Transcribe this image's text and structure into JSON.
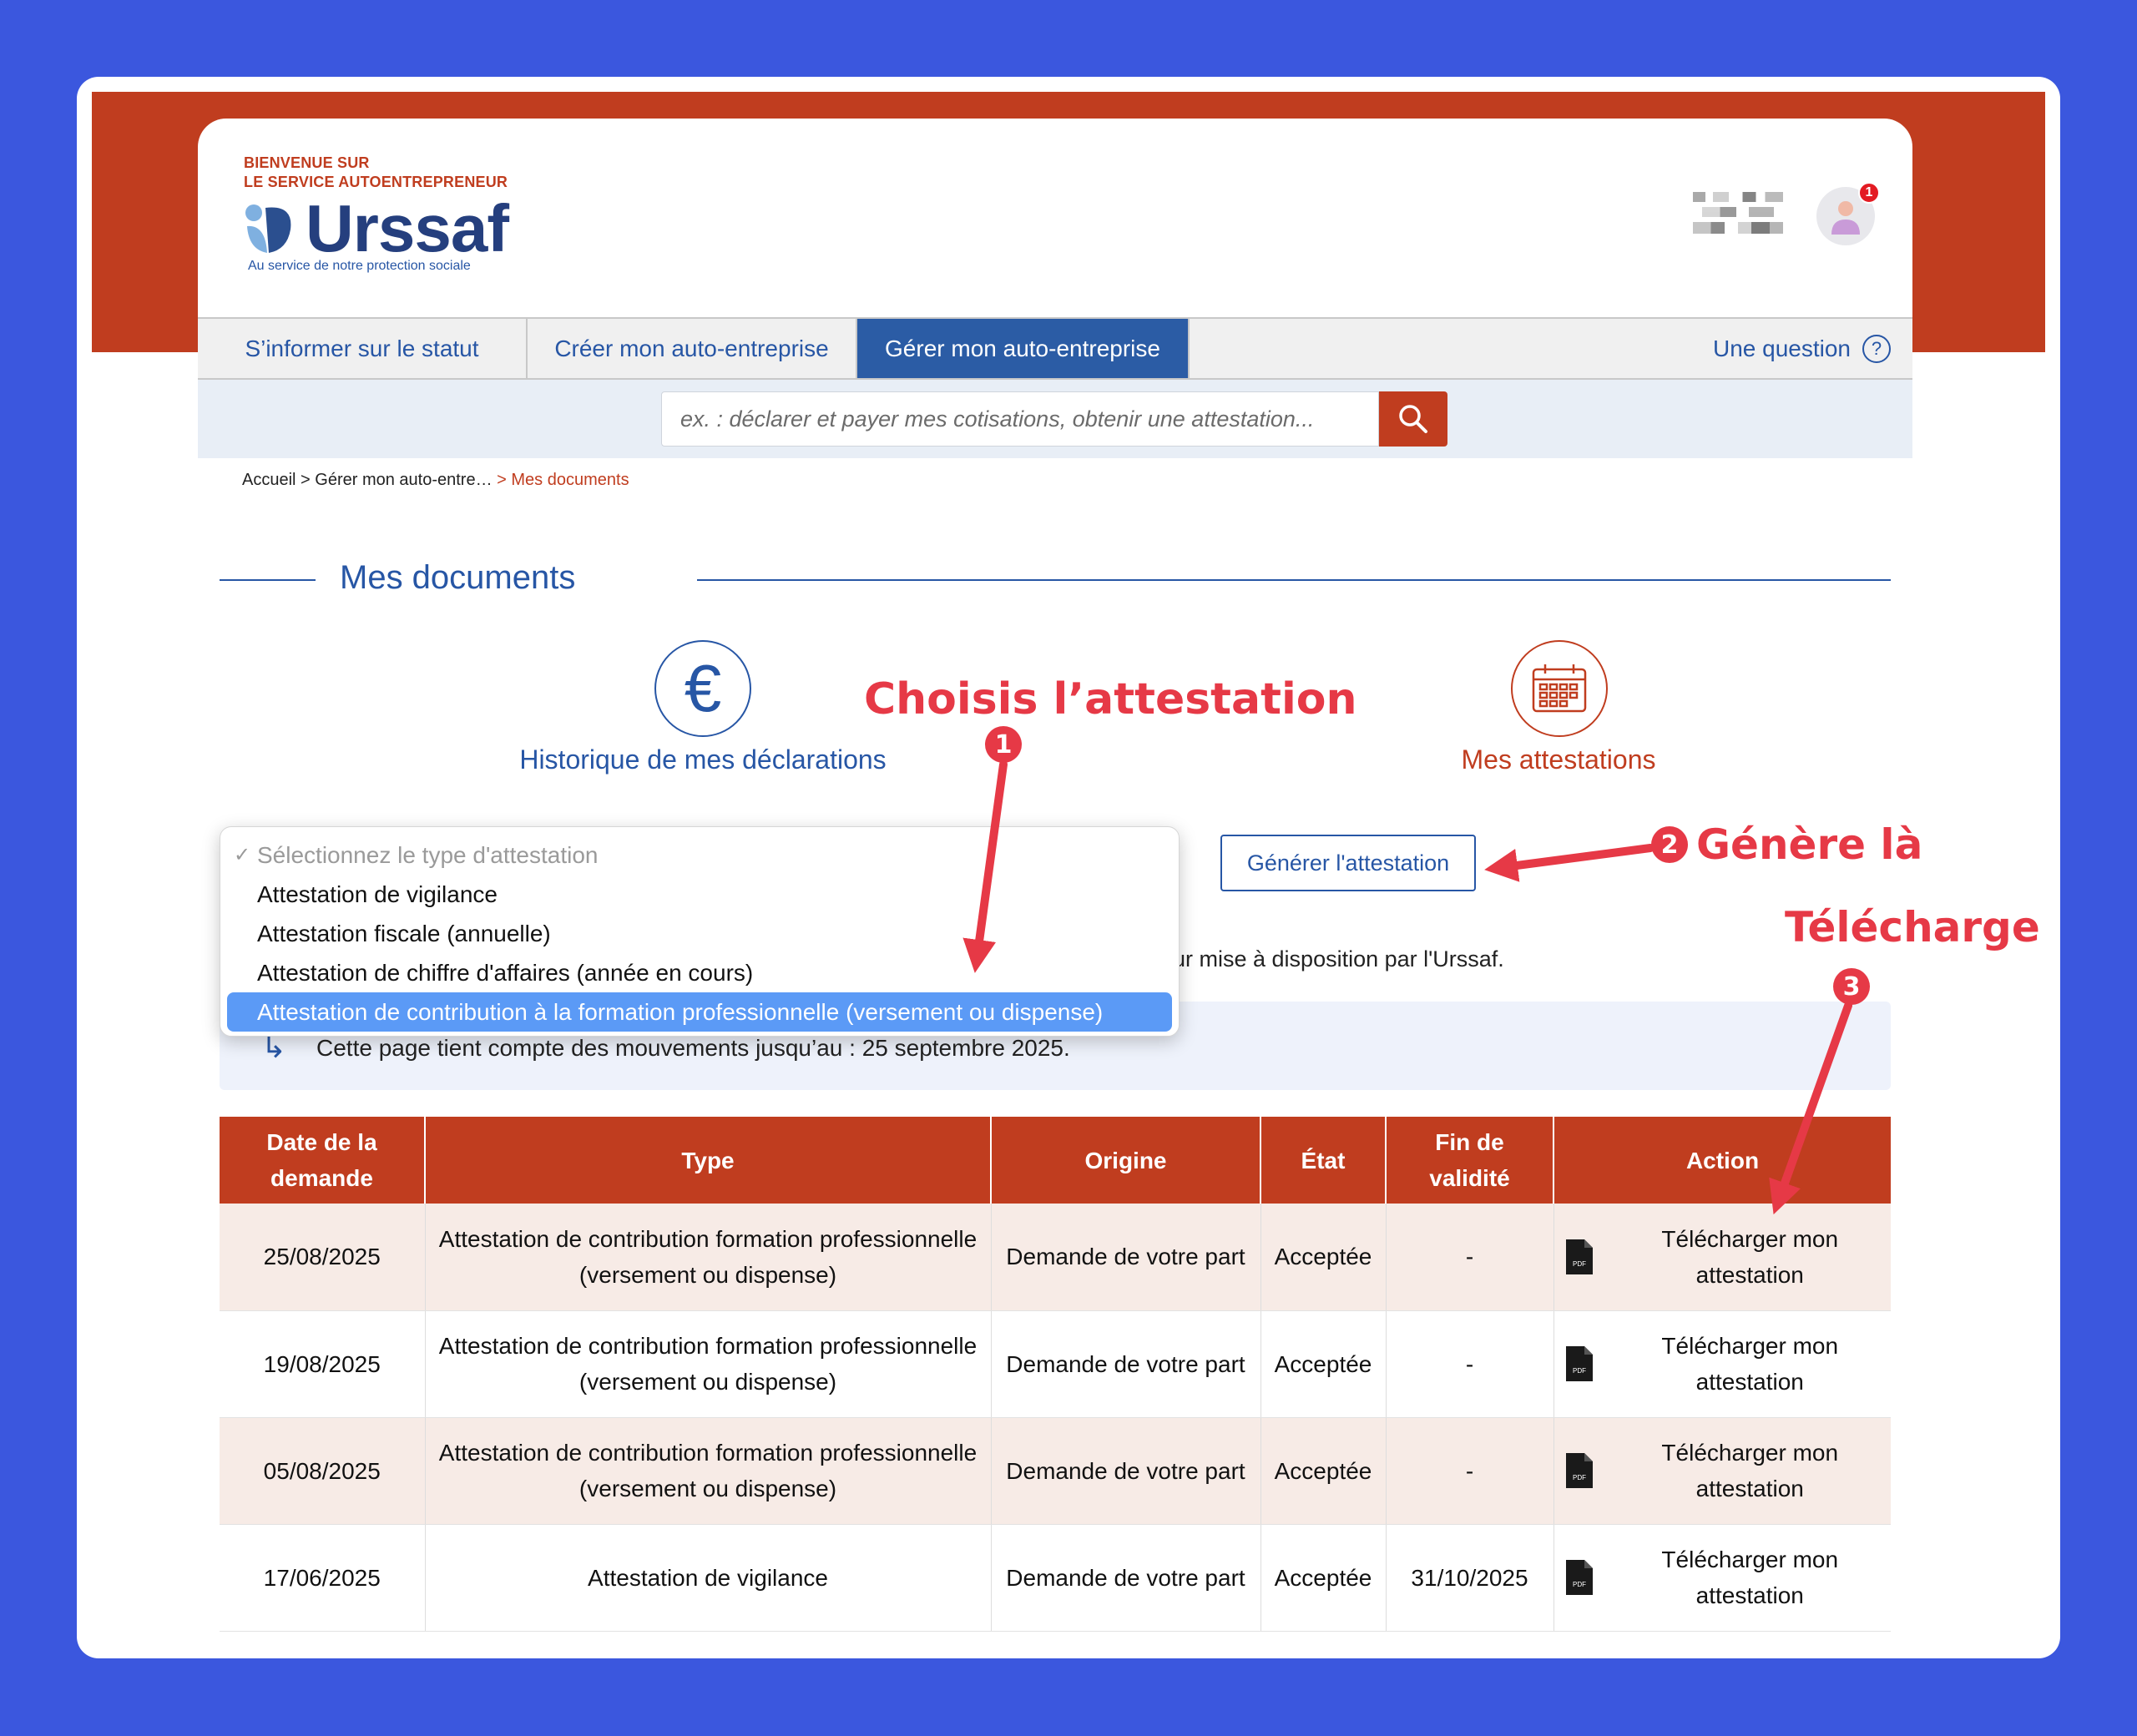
{
  "header": {
    "welcome_line1": "BIENVENUE SUR",
    "welcome_line2": "LE SERVICE AUTOENTREPRENEUR",
    "brand": "Urssaf",
    "tagline": "Au service de notre protection sociale",
    "notification_count": "1"
  },
  "nav": {
    "tabs": [
      {
        "label": "S’informer sur le statut"
      },
      {
        "label": "Créer mon auto-entreprise"
      },
      {
        "label": "Gérer mon auto-entreprise"
      }
    ],
    "question": "Une question",
    "question_mark": "?"
  },
  "search": {
    "placeholder": "ex. : déclarer et payer mes cotisations, obtenir une attestation..."
  },
  "breadcrumb": {
    "path": "Accueil > Gérer mon auto-entre…",
    "current": "> Mes documents"
  },
  "page": {
    "title": "Mes documents",
    "link_history": "Historique de mes déclarations",
    "link_attestations": "Mes attestations",
    "euro_symbol": "€",
    "generate_button": "Générer l'attestation",
    "info_line": "ur mise à disposition par l'Urssaf.",
    "info_box": "Cette page tient compte des mouvements jusqu’au : 25 septembre 2025."
  },
  "dropdown": {
    "placeholder": "Sélectionnez le type d'attestation",
    "check": "✓",
    "options": [
      "Attestation de vigilance",
      "Attestation fiscale (annuelle)",
      "Attestation de chiffre d'affaires (année en cours)",
      "Attestation de contribution à la formation professionnelle (versement ou dispense)"
    ]
  },
  "table": {
    "headers": [
      "Date de la demande",
      "Type",
      "Origine",
      "État",
      "Fin de validité",
      "Action"
    ],
    "rows": [
      {
        "date": "25/08/2025",
        "type": "Attestation de contribution formation professionnelle (versement ou dispense)",
        "origin": "Demande de votre part",
        "state": "Acceptée",
        "validity": "-",
        "action": "Télécharger mon attestation"
      },
      {
        "date": "19/08/2025",
        "type": "Attestation de contribution formation professionnelle (versement ou dispense)",
        "origin": "Demande de votre part",
        "state": "Acceptée",
        "validity": "-",
        "action": "Télécharger mon attestation"
      },
      {
        "date": "05/08/2025",
        "type": "Attestation de contribution formation professionnelle (versement ou dispense)",
        "origin": "Demande de votre part",
        "state": "Acceptée",
        "validity": "-",
        "action": "Télécharger mon attestation"
      },
      {
        "date": "17/06/2025",
        "type": "Attestation de vigilance",
        "origin": "Demande de votre part",
        "state": "Acceptée",
        "validity": "31/10/2025",
        "action": "Télécharger mon attestation"
      }
    ],
    "pdf_label": "PDF"
  },
  "annotations": {
    "step1": "Choisis l’attestation",
    "step2": "Génère là",
    "step3": "Télécharge",
    "n1": "1",
    "n2": "2",
    "n3": "3",
    "color": "#e63946"
  },
  "colors": {
    "brand_red": "#c03d1f",
    "brand_blue": "#2756a5",
    "background": "#3b57de"
  }
}
